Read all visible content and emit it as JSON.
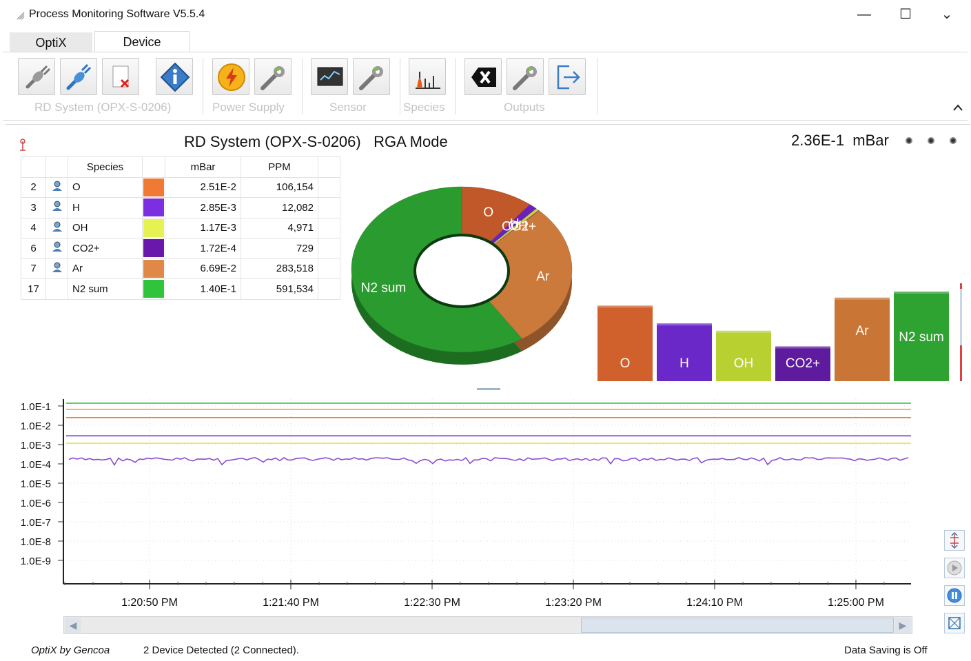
{
  "window": {
    "title": "Process Monitoring Software V5.5.4",
    "minimize": "—",
    "maximize": "☐",
    "close": "⌄"
  },
  "tabs": [
    {
      "label": "OptiX"
    },
    {
      "label": "Device"
    }
  ],
  "ribbon": {
    "groups": [
      {
        "label": "RD System (OPX-S-0206)"
      },
      {
        "label": "Power Supply"
      },
      {
        "label": "Sensor"
      },
      {
        "label": "Species"
      },
      {
        "label": "Outputs"
      }
    ],
    "collapse": "^"
  },
  "header": {
    "title": "RD System (OPX-S-0206)",
    "mode": "RGA Mode",
    "pressure_value": "2.36E-1",
    "pressure_unit": "mBar"
  },
  "species_table": {
    "columns": [
      "Species",
      "mBar",
      "PPM"
    ],
    "rows": [
      {
        "idx": "2",
        "name": "O",
        "color": "#f07a33",
        "mbar": "2.51E-2",
        "ppm": "106,154",
        "user": true
      },
      {
        "idx": "3",
        "name": "H",
        "color": "#7b2fe0",
        "mbar": "2.85E-3",
        "ppm": "12,082",
        "user": true
      },
      {
        "idx": "4",
        "name": "OH",
        "color": "#e6f252",
        "mbar": "1.17E-3",
        "ppm": "4,971",
        "user": true
      },
      {
        "idx": "6",
        "name": "CO2+",
        "color": "#6a18ac",
        "mbar": "1.72E-4",
        "ppm": "729",
        "user": true
      },
      {
        "idx": "7",
        "name": "Ar",
        "color": "#e08848",
        "mbar": "6.69E-2",
        "ppm": "283,518",
        "user": true
      },
      {
        "idx": "17",
        "name": "N2 sum",
        "color": "#2fc43a",
        "mbar": "1.40E-1",
        "ppm": "591,534",
        "user": false
      }
    ]
  },
  "chart_data": [
    {
      "type": "pie",
      "labels": [
        "O",
        "H",
        "OH",
        "CO2+",
        "Ar",
        "N2 sum"
      ],
      "values": [
        106154,
        12082,
        4971,
        729,
        283518,
        591534
      ],
      "colors": [
        "#c0582a",
        "#6a22bf",
        "#c7d33a",
        "#5a1a9a",
        "#cc7a3c",
        "#2a9b2f"
      ],
      "donut": true
    },
    {
      "type": "bar",
      "categories": [
        "O",
        "H",
        "OH",
        "CO2+",
        "Ar",
        "N2 sum"
      ],
      "values": [
        0.0251,
        0.00285,
        0.00117,
        0.000172,
        0.0669,
        0.14
      ],
      "colors": [
        "#d0612c",
        "#6b28c8",
        "#b8d131",
        "#5e1b9e",
        "#c97536",
        "#2ea331"
      ],
      "yscale": "log"
    },
    {
      "type": "line",
      "yscale": "log",
      "ylim": [
        1e-10,
        0.1
      ],
      "y_ticks": [
        "1.0E-1",
        "1.0E-2",
        "1.0E-3",
        "1.0E-4",
        "1.0E-5",
        "1.0E-6",
        "1.0E-7",
        "1.0E-8",
        "1.0E-9"
      ],
      "x_ticks": [
        "1:20:50 PM",
        "1:21:40 PM",
        "1:22:30 PM",
        "1:23:20 PM",
        "1:24:10 PM",
        "1:25:00 PM"
      ],
      "grid": true,
      "series": [
        {
          "name": "N2 sum",
          "color": "#3dbb3d",
          "level": 0.14
        },
        {
          "name": "Ar",
          "color": "#e5a06a",
          "level": 0.0669
        },
        {
          "name": "O",
          "color": "#f07a33",
          "level": 0.0251
        },
        {
          "name": "H",
          "color": "#7b2fe0",
          "level": 0.00285
        },
        {
          "name": "OH",
          "color": "#dfe84a",
          "level": 0.00117
        },
        {
          "name": "CO2+",
          "color": "#8d4bd0",
          "level": 0.000172,
          "noisy": true
        }
      ]
    }
  ],
  "side_buttons": [
    {
      "name": "zoom-fit-icon"
    },
    {
      "name": "play-icon"
    },
    {
      "name": "pause-icon"
    },
    {
      "name": "zoom-reset-icon"
    }
  ],
  "scrollbar": {
    "left": "◀",
    "right": "▶"
  },
  "status": {
    "brand": "OptiX by Gencoa",
    "devices": "2 Device Detected (2 Connected).",
    "saving": "Data Saving is Off"
  }
}
